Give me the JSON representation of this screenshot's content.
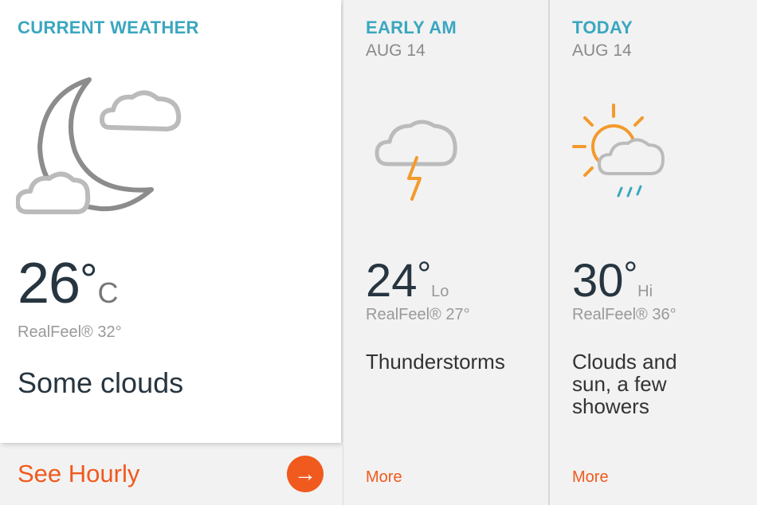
{
  "colors": {
    "heading": "#3aa7c0",
    "accent": "#f05a1e",
    "text": "#263540",
    "muted": "#999999"
  },
  "current": {
    "heading": "CURRENT WEATHER",
    "icon": "moon-clouds-icon",
    "temp": "26",
    "degree": "°",
    "unit": "C",
    "realfeel": "RealFeel® 32°",
    "phrase": "Some clouds",
    "see_hourly": "See Hourly",
    "arrow": "→"
  },
  "early": {
    "heading": "EARLY AM",
    "date": "AUG 14",
    "icon": "thunderstorm-icon",
    "temp": "24",
    "degree": "°",
    "hilo": "Lo",
    "realfeel": "RealFeel® 27°",
    "phrase": "Thunderstorms",
    "more": "More"
  },
  "today": {
    "heading": "TODAY",
    "date": "AUG 14",
    "icon": "sun-clouds-showers-icon",
    "temp": "30",
    "degree": "°",
    "hilo": "Hi",
    "realfeel": "RealFeel® 36°",
    "phrase": "Clouds and sun, a few showers",
    "more": "More"
  }
}
